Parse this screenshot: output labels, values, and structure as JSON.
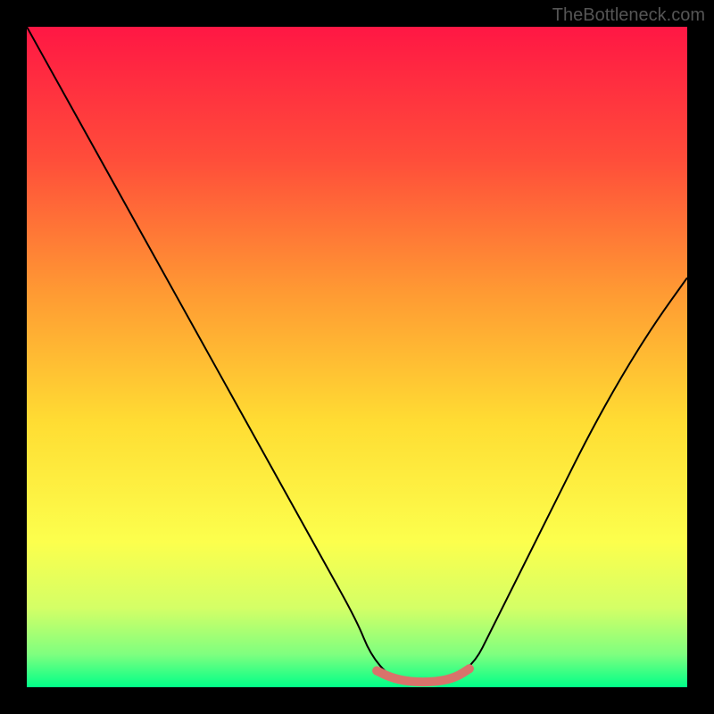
{
  "watermark": "TheBottleneck.com",
  "chart_data": {
    "type": "line",
    "title": "",
    "xlabel": "",
    "ylabel": "",
    "xlim": [
      0,
      100
    ],
    "ylim": [
      0,
      100
    ],
    "series": [
      {
        "name": "bottleneck-curve",
        "x": [
          0,
          5,
          10,
          15,
          20,
          25,
          30,
          35,
          40,
          45,
          50,
          52,
          55,
          58,
          62,
          65,
          68,
          70,
          75,
          80,
          85,
          90,
          95,
          100
        ],
        "y": [
          100,
          91,
          82,
          73,
          64,
          55,
          46,
          37,
          28,
          19,
          10,
          5,
          1.5,
          0.8,
          0.8,
          1.5,
          4,
          8,
          18,
          28,
          38,
          47,
          55,
          62
        ]
      },
      {
        "name": "optimal-zone-highlight",
        "x": [
          53,
          55,
          58,
          62,
          65,
          67
        ],
        "y": [
          2.5,
          1.5,
          0.8,
          0.8,
          1.5,
          2.8
        ]
      }
    ],
    "gradient_stops": [
      {
        "offset": 0,
        "color": "#ff1744"
      },
      {
        "offset": 20,
        "color": "#ff4d3a"
      },
      {
        "offset": 40,
        "color": "#ff9933"
      },
      {
        "offset": 60,
        "color": "#ffdd33"
      },
      {
        "offset": 78,
        "color": "#fcff4d"
      },
      {
        "offset": 88,
        "color": "#d4ff66"
      },
      {
        "offset": 95,
        "color": "#7fff7f"
      },
      {
        "offset": 100,
        "color": "#00ff88"
      }
    ],
    "highlight_color": "#d9736b"
  }
}
